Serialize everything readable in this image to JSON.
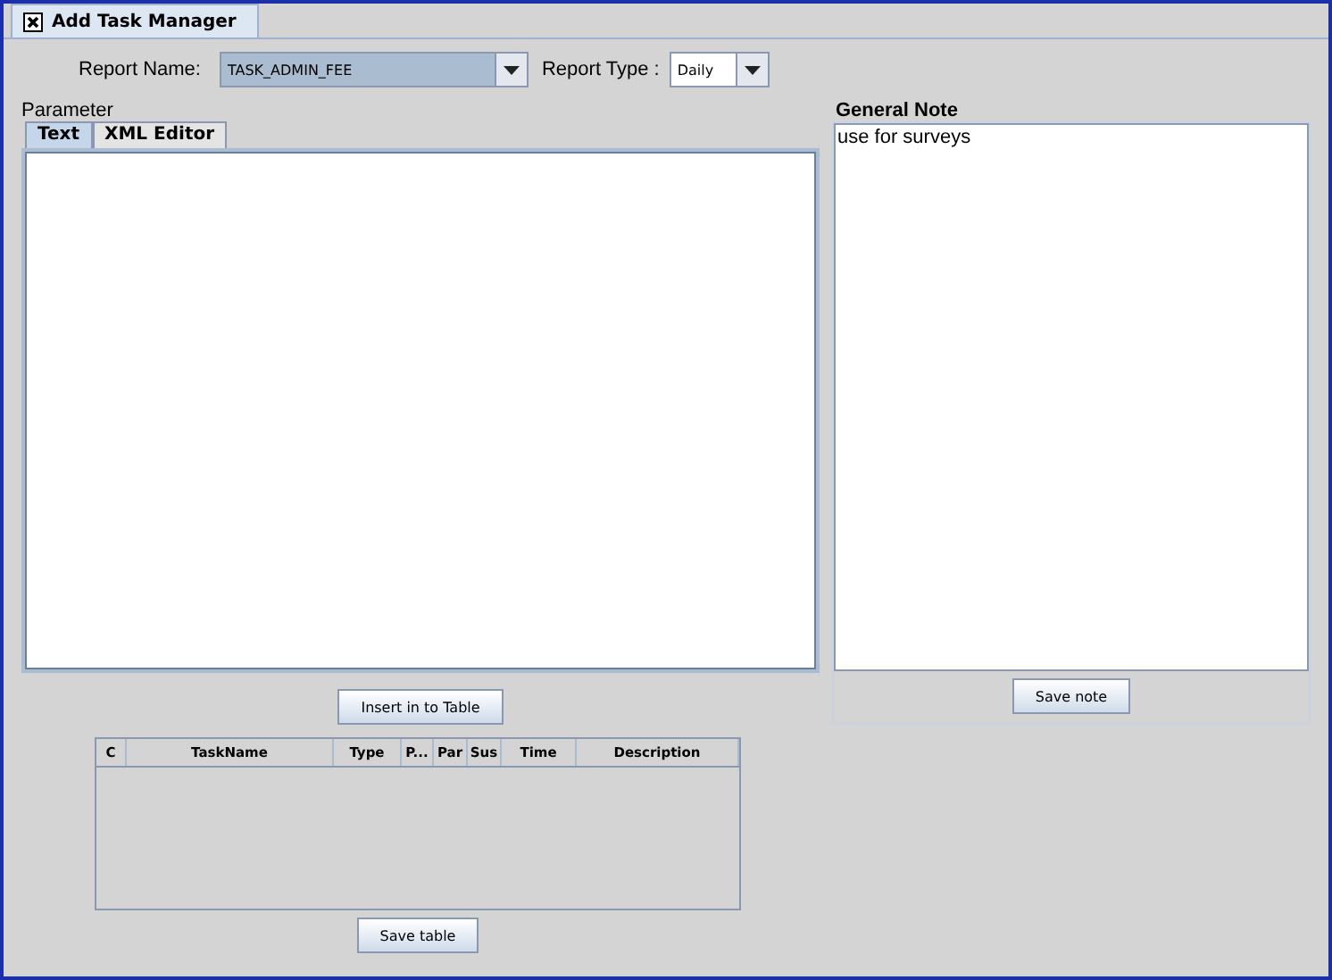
{
  "window": {
    "tab_title": "Add Task Manager"
  },
  "report_name": {
    "label": "Report Name:",
    "value": "TASK_ADMIN_FEE"
  },
  "report_type": {
    "label": "Report Type :",
    "value": "Daily"
  },
  "parameter": {
    "label": "Parameter",
    "tabs": [
      {
        "label": "Text",
        "selected": true
      },
      {
        "label": "XML Editor",
        "selected": false
      }
    ]
  },
  "general_note": {
    "label": "General Note",
    "value": "use for surveys",
    "button": "Save note"
  },
  "insert_button": "Insert in to Table",
  "table": {
    "columns": [
      "C",
      "TaskName",
      "Type",
      "P...",
      "Par",
      "Sus",
      "Time",
      "Description"
    ]
  },
  "save_table_button": "Save table"
}
